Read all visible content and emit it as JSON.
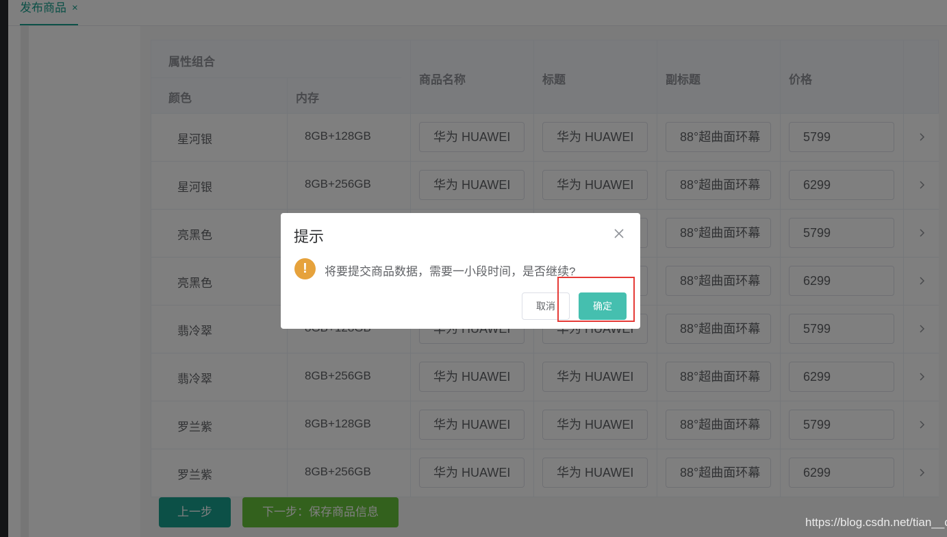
{
  "tab": {
    "label": "发布商品",
    "close": "×"
  },
  "table": {
    "header": {
      "group": "属性组合",
      "color": "颜色",
      "memory": "内存",
      "name": "商品名称",
      "title": "标题",
      "subtitle": "副标题",
      "price": "价格"
    },
    "rows": [
      {
        "color": "星河银",
        "memory": "8GB+128GB",
        "name": "华为 HUAWEI",
        "title": "华为 HUAWEI",
        "subtitle": "88°超曲面环幕",
        "price": "5799"
      },
      {
        "color": "星河银",
        "memory": "8GB+256GB",
        "name": "华为 HUAWEI",
        "title": "华为 HUAWEI",
        "subtitle": "88°超曲面环幕",
        "price": "6299"
      },
      {
        "color": "亮黑色",
        "memory": "",
        "name": "",
        "title": "",
        "subtitle": "88°超曲面环幕",
        "price": "5799"
      },
      {
        "color": "亮黑色",
        "memory": "",
        "name": "",
        "title": "",
        "subtitle": "88°超曲面环幕",
        "price": "6299"
      },
      {
        "color": "翡冷翠",
        "memory": "8GB+128GB",
        "name": "华为 HUAWEI",
        "title": "华为 HUAWEI",
        "subtitle": "88°超曲面环幕",
        "price": "5799"
      },
      {
        "color": "翡冷翠",
        "memory": "8GB+256GB",
        "name": "华为 HUAWEI",
        "title": "华为 HUAWEI",
        "subtitle": "88°超曲面环幕",
        "price": "6299"
      },
      {
        "color": "罗兰紫",
        "memory": "8GB+128GB",
        "name": "华为 HUAWEI",
        "title": "华为 HUAWEI",
        "subtitle": "88°超曲面环幕",
        "price": "5799"
      },
      {
        "color": "罗兰紫",
        "memory": "8GB+256GB",
        "name": "华为 HUAWEI",
        "title": "华为 HUAWEI",
        "subtitle": "88°超曲面环幕",
        "price": "6299"
      }
    ],
    "row_icon": "chevron-right-icon"
  },
  "buttons": {
    "prev": "上一步",
    "next": "下一步：保存商品信息"
  },
  "dialog": {
    "title": "提示",
    "message": "将要提交商品数据，需要一小段时间，是否继续?",
    "warn_symbol": "!",
    "cancel": "取消",
    "confirm": "确定"
  },
  "watermark": "https://blog.csdn.net/tian__c",
  "colors": {
    "accent": "#18a08f",
    "confirm": "#45bfaf",
    "next": "#67c23a",
    "warning": "#e6a23c",
    "highlight": "#e53935"
  }
}
